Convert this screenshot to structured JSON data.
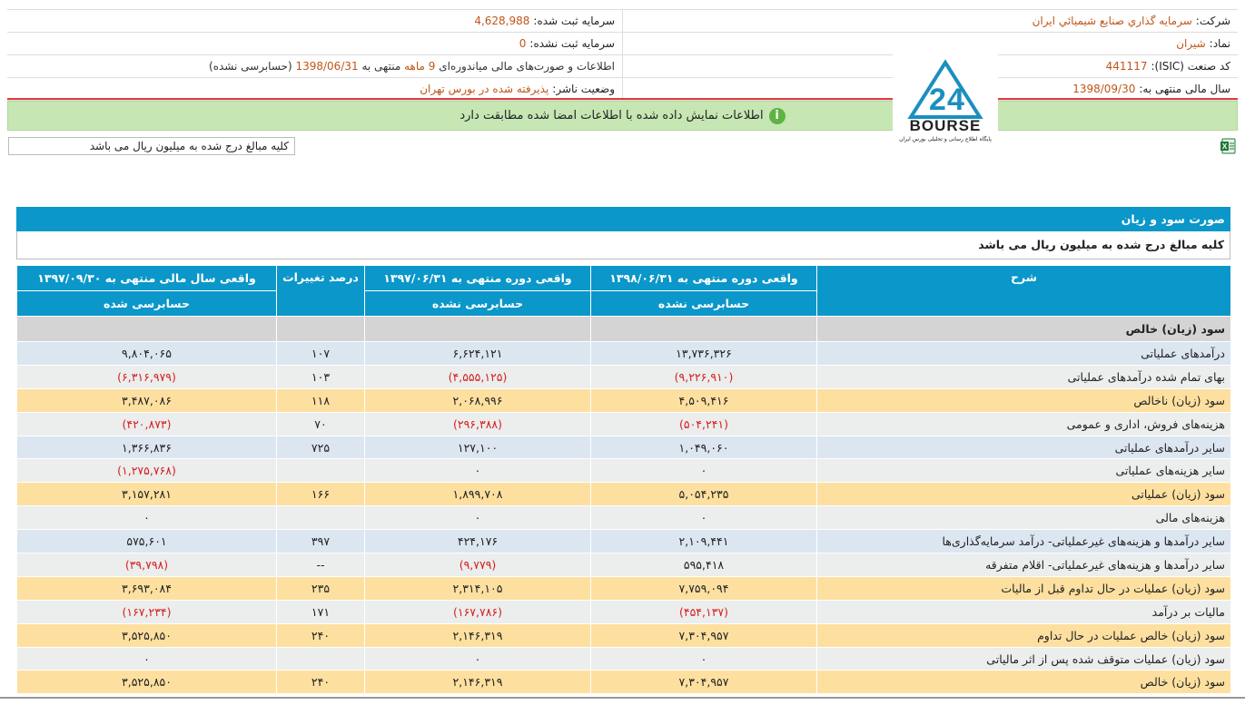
{
  "header": {
    "company_label": "شرکت:",
    "company_value": "سرمایه گذاري صنایع شیمیائي ایران",
    "registered_capital_label": "سرمایه ثبت شده:",
    "registered_capital_value": "4,628,988",
    "symbol_label": "نماد:",
    "symbol_value": "شیران",
    "unregistered_capital_label": "سرمایه ثبت نشده:",
    "unregistered_capital_value": "0",
    "isic_label": "کد صنعت (ISIC):",
    "isic_value": "441117",
    "report_pre": "اطلاعات و صورت‌های مالی میاندوره‌ای",
    "report_period": "9 ماهه",
    "report_mid": "منتهی به",
    "report_date": "1398/06/31",
    "report_post": "(حسابرسی نشده)",
    "fiscal_year_label": "سال مالی منتهی به:",
    "fiscal_year_value": "1398/09/30",
    "publisher_label": "وضعیت ناشر:",
    "publisher_value": "پذیرفته شده در بورس تهران"
  },
  "notice": {
    "icon": "info-icon",
    "text": "اطلاعات نمایش داده شده با اطلاعات امضا شده مطابقت دارد"
  },
  "logo": {
    "text": "BOURSE",
    "caption": "پایگاه اطلاع رسانی و تحلیلی بورس ایران",
    "color": "#1b8fc0"
  },
  "unit_note": "کلیه مبالغ درج شده به میلیون ریال می باشد",
  "section": {
    "title": "صورت سود و زیان",
    "subtitle": "کلیه مبالغ درج شده به میلیون ریال می باشد"
  },
  "table": {
    "headers": {
      "desc": "شرح",
      "col1": "واقعی دوره منتهی به ۱۳۹۸/۰۶/۳۱",
      "col2": "واقعی دوره منتهی به ۱۳۹۷/۰۶/۳۱",
      "col3": "درصد تغییرات",
      "col4": "واقعی سال مالی منتهی به ۱۳۹۷/۰۹/۳۰",
      "sub1": "حسابرسی نشده",
      "sub2": "حسابرسی نشده",
      "sub4": "حسابرسی شده"
    },
    "group_title": "سود (زیان) خالص",
    "rows": [
      {
        "desc": "درآمدهای عملیاتی",
        "c1": "۱۳,۷۳۶,۳۲۶",
        "c2": "۶,۶۲۴,۱۲۱",
        "c3": "۱۰۷",
        "c4": "۹,۸۰۴,۰۶۵"
      },
      {
        "desc": "بهای تمام شده درآمدهای عملیاتی",
        "c1": "(۹,۲۲۶,۹۱۰)",
        "c2": "(۴,۵۵۵,۱۲۵)",
        "c3": "۱۰۳",
        "c4": "(۶,۳۱۶,۹۷۹)"
      },
      {
        "desc": "سود (زیان) ناخالص",
        "c1": "۴,۵۰۹,۴۱۶",
        "c2": "۲,۰۶۸,۹۹۶",
        "c3": "۱۱۸",
        "c4": "۳,۴۸۷,۰۸۶"
      },
      {
        "desc": "هزینه‌های فروش، اداری و عمومی",
        "c1": "(۵۰۴,۲۴۱)",
        "c2": "(۲۹۶,۳۸۸)",
        "c3": "۷۰",
        "c4": "(۴۲۰,۸۷۳)"
      },
      {
        "desc": "سایر درآمدهای عملیاتی",
        "c1": "۱,۰۴۹,۰۶۰",
        "c2": "۱۲۷,۱۰۰",
        "c3": "۷۲۵",
        "c4": "۱,۳۶۶,۸۳۶"
      },
      {
        "desc": "سایر هزینه‌های عملیاتی",
        "c1": "۰",
        "c2": "۰",
        "c3": "",
        "c4": "(۱,۲۷۵,۷۶۸)"
      },
      {
        "desc": "سود (زیان) عملیاتی",
        "c1": "۵,۰۵۴,۲۳۵",
        "c2": "۱,۸۹۹,۷۰۸",
        "c3": "۱۶۶",
        "c4": "۳,۱۵۷,۲۸۱"
      },
      {
        "desc": "هزینه‌های مالی",
        "c1": "۰",
        "c2": "۰",
        "c3": "",
        "c4": "۰"
      },
      {
        "desc": "سایر درآمدها و هزینه‌های غیرعملیاتی- درآمد سرمایه‌گذاری‌ها",
        "c1": "۲,۱۰۹,۴۴۱",
        "c2": "۴۲۴,۱۷۶",
        "c3": "۳۹۷",
        "c4": "۵۷۵,۶۰۱"
      },
      {
        "desc": "سایر درآمدها و هزینه‌های غیرعملیاتی- اقلام متفرقه",
        "c1": "۵۹۵,۴۱۸",
        "c2": "(۹,۷۷۹)",
        "c3": "--",
        "c4": "(۳۹,۷۹۸)"
      },
      {
        "desc": "سود (زیان) عملیات در حال تداوم قبل از مالیات",
        "c1": "۷,۷۵۹,۰۹۴",
        "c2": "۲,۳۱۴,۱۰۵",
        "c3": "۲۳۵",
        "c4": "۳,۶۹۳,۰۸۴"
      },
      {
        "desc": "مالیات بر درآمد",
        "c1": "(۴۵۴,۱۳۷)",
        "c2": "(۱۶۷,۷۸۶)",
        "c3": "۱۷۱",
        "c4": "(۱۶۷,۲۳۴)"
      },
      {
        "desc": "سود (زیان) خالص عملیات در حال تداوم",
        "c1": "۷,۳۰۴,۹۵۷",
        "c2": "۲,۱۴۶,۳۱۹",
        "c3": "۲۴۰",
        "c4": "۳,۵۲۵,۸۵۰"
      },
      {
        "desc": "سود (زیان) عملیات متوقف شده پس از اثر مالیاتی",
        "c1": "۰",
        "c2": "۰",
        "c3": "",
        "c4": "۰"
      },
      {
        "desc": "سود (زیان) خالص",
        "c1": "۷,۳۰۴,۹۵۷",
        "c2": "۲,۱۴۶,۳۱۹",
        "c3": "۲۴۰",
        "c4": "۳,۵۲۵,۸۵۰"
      }
    ],
    "row_colors": {
      "blue": "#dce6f0",
      "gray": "#eceded",
      "gold": "#fde0a0"
    }
  }
}
